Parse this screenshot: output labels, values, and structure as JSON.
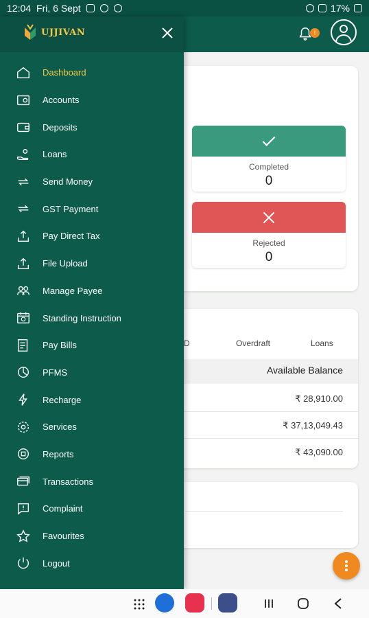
{
  "statusbar": {
    "time": "12:04",
    "date": "Fri, 6 Sept",
    "battery": "17%"
  },
  "brand": {
    "name": "UJJIVAN",
    "accent": "#f2c744",
    "drawer_bg": "#0d5c4b"
  },
  "header": {
    "notification_count": "!"
  },
  "drawer": {
    "items": [
      {
        "label": "Dashboard",
        "icon": "home-icon"
      },
      {
        "label": "Accounts",
        "icon": "accounts-icon"
      },
      {
        "label": "Deposits",
        "icon": "wallet-icon"
      },
      {
        "label": "Loans",
        "icon": "loans-icon"
      },
      {
        "label": "Send Money",
        "icon": "transfer-icon"
      },
      {
        "label": "GST Payment",
        "icon": "transfer-icon"
      },
      {
        "label": "Pay Direct Tax",
        "icon": "upload-icon"
      },
      {
        "label": "File Upload",
        "icon": "upload-icon"
      },
      {
        "label": "Manage Payee",
        "icon": "payee-icon"
      },
      {
        "label": "Standing Instruction",
        "icon": "calendar-icon"
      },
      {
        "label": "Pay Bills",
        "icon": "bills-icon"
      },
      {
        "label": "PFMS",
        "icon": "pie-icon"
      },
      {
        "label": "Recharge",
        "icon": "bolt-icon"
      },
      {
        "label": "Services",
        "icon": "gear-icon"
      },
      {
        "label": "Reports",
        "icon": "reports-icon"
      },
      {
        "label": "Transactions",
        "icon": "card-icon"
      },
      {
        "label": "Complaint",
        "icon": "complaint-icon"
      },
      {
        "label": "Favourites",
        "icon": "star-icon"
      },
      {
        "label": "Logout",
        "icon": "power-icon"
      }
    ]
  },
  "status_cards": {
    "completed": {
      "label": "Completed",
      "count": "0",
      "color": "#3a9a7d"
    },
    "rejected": {
      "label": "Rejected",
      "count": "0",
      "color": "#e05555"
    }
  },
  "balances": {
    "tabs": [
      "D",
      "Overdraft",
      "Loans"
    ],
    "column_header": "Available Balance",
    "rows": [
      "₹ 28,910.00",
      "₹ 37,13,049.43",
      "₹ 43,090.00"
    ]
  }
}
